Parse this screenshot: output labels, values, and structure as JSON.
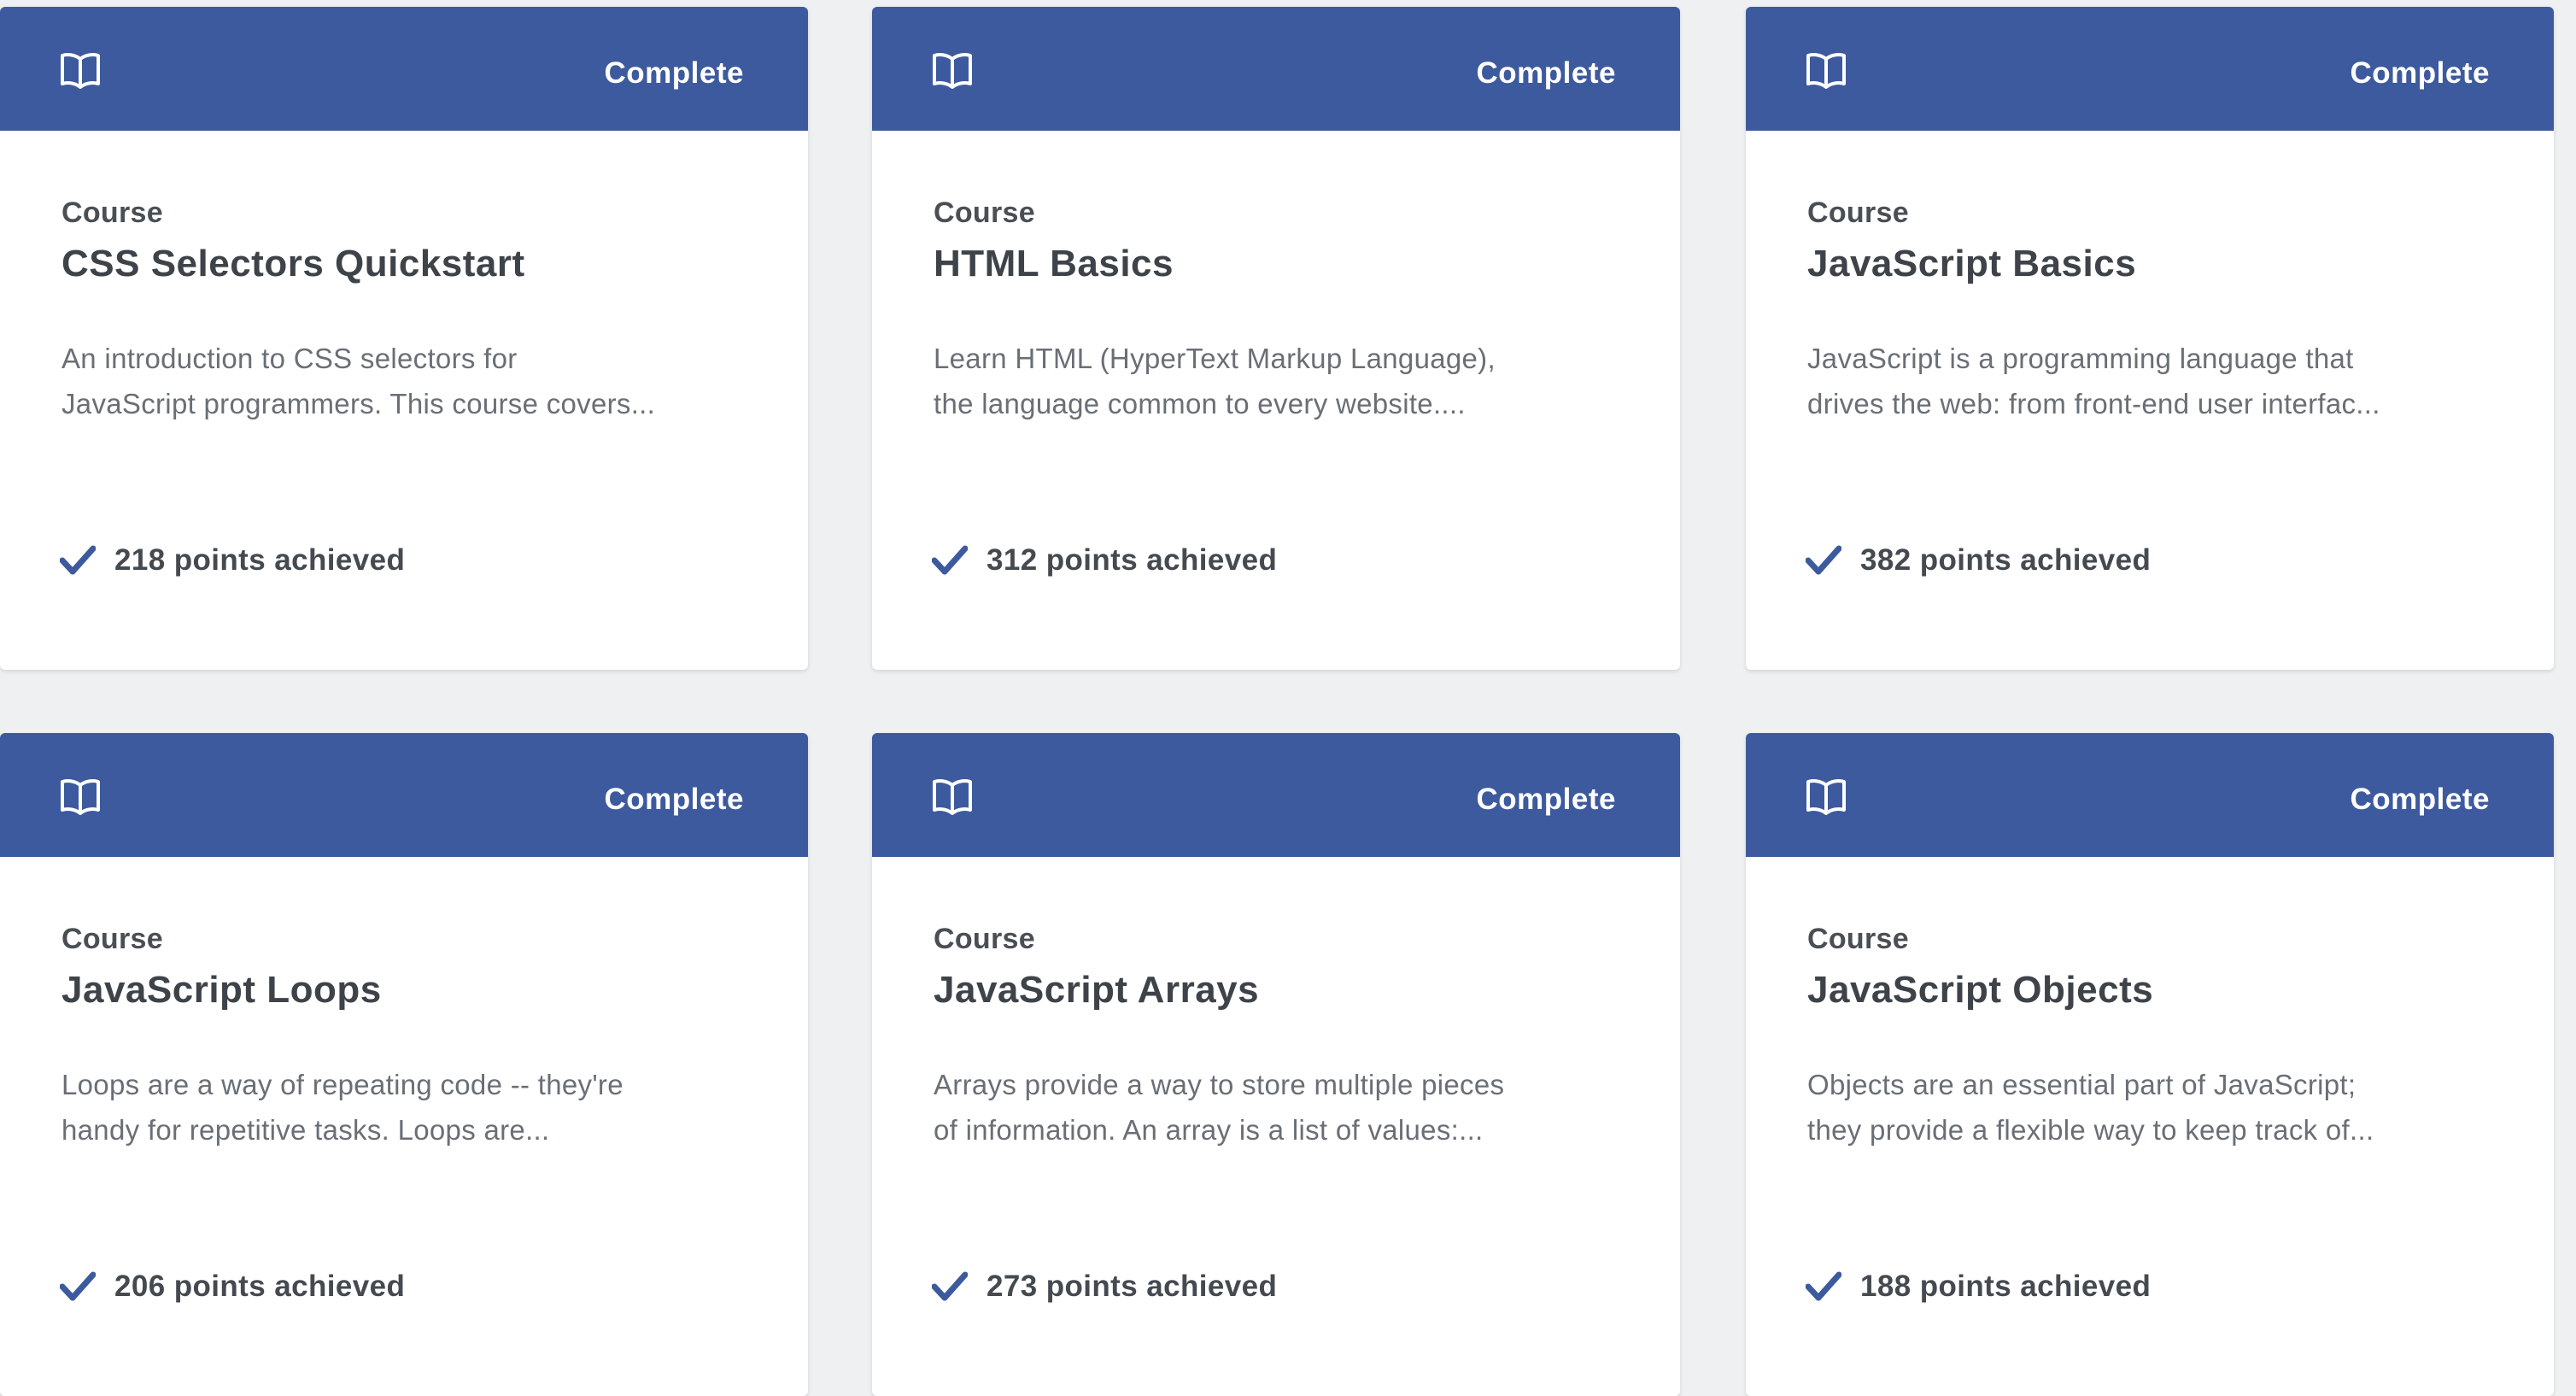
{
  "colors": {
    "header": "#3d5a9e",
    "background": "#eef0f2",
    "card": "#ffffff",
    "check": "#3d5a9e"
  },
  "cards": [
    {
      "status": "Complete",
      "icon": "book-icon",
      "type": "Course",
      "title": "CSS Selectors Quickstart",
      "description": "An introduction to CSS selectors for\nJavaScript programmers. This course covers...",
      "points": "218 points achieved"
    },
    {
      "status": "Complete",
      "icon": "book-icon",
      "type": "Course",
      "title": "HTML Basics",
      "description": "Learn HTML (HyperText Markup Language),\nthe language common to every website....",
      "points": "312 points achieved"
    },
    {
      "status": "Complete",
      "icon": "book-icon",
      "type": "Course",
      "title": "JavaScript Basics",
      "description": "JavaScript is a programming language that\ndrives the web: from front-end user interfac...",
      "points": "382 points achieved"
    },
    {
      "status": "Complete",
      "icon": "book-icon",
      "type": "Course",
      "title": "JavaScript Loops",
      "description": "Loops are a way of repeating code -- they're\nhandy for repetitive tasks. Loops are...",
      "points": "206 points achieved"
    },
    {
      "status": "Complete",
      "icon": "book-icon",
      "type": "Course",
      "title": "JavaScript Arrays",
      "description": "Arrays provide a way to store multiple pieces\nof information. An array is a list of values:...",
      "points": "273 points achieved"
    },
    {
      "status": "Complete",
      "icon": "book-icon",
      "type": "Course",
      "title": "JavaScript Objects",
      "description": "Objects are an essential part of JavaScript;\nthey provide a flexible way to keep track of...",
      "points": "188 points achieved"
    }
  ]
}
